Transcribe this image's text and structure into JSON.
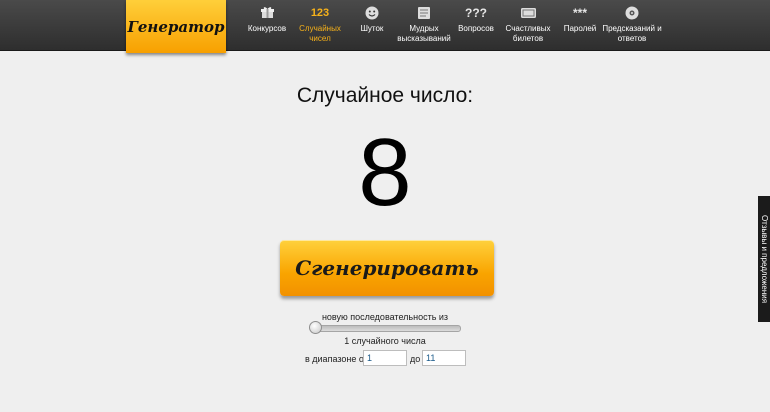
{
  "logo": "Генератор",
  "nav": {
    "items": [
      {
        "label": "Конкурсов",
        "icon": "gift-icon"
      },
      {
        "label": "Случайных чисел",
        "icon": "numbers-icon",
        "icon_text": "123",
        "active": true
      },
      {
        "label": "Шуток",
        "icon": "smiley-icon"
      },
      {
        "label": "Мудрых высказываний",
        "icon": "scroll-icon"
      },
      {
        "label": "Вопросов",
        "icon": "question-marks-icon",
        "icon_text": "???"
      },
      {
        "label": "Счастливых билетов",
        "icon": "ticket-icon"
      },
      {
        "label": "Паролей",
        "icon": "asterisks-icon",
        "icon_text": "***"
      },
      {
        "label": "Предсказаний и ответов",
        "icon": "ball-icon"
      }
    ]
  },
  "main": {
    "heading": "Случайное число:",
    "number": "8",
    "button_label": "Сгенерировать",
    "sequence_label": "новую последовательность из",
    "slider_value": 1,
    "count_label": "1 случайного числа",
    "range_label_from": "в диапазоне от",
    "range_from": "1",
    "range_label_to": "до",
    "range_to": "11"
  },
  "side_tab": {
    "label": "Отзывы и предложения"
  },
  "colors": {
    "accent": "#f7a000",
    "topbar": "#3a3a3a",
    "active_nav": "#f7b21a"
  }
}
